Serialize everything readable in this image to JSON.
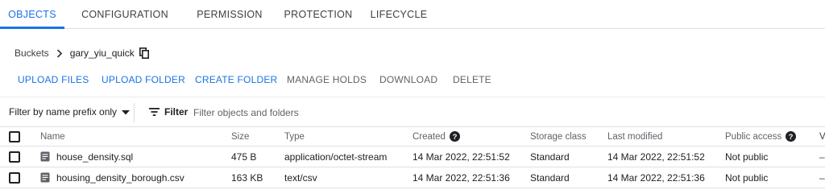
{
  "tabs": [
    {
      "label": "OBJECTS",
      "active": true
    },
    {
      "label": "CONFIGURATION",
      "active": false
    },
    {
      "label": "PERMISSION",
      "active": false
    },
    {
      "label": "PROTECTION",
      "active": false
    },
    {
      "label": "LIFECYCLE",
      "active": false
    }
  ],
  "breadcrumb": {
    "root": "Buckets",
    "current": "gary_yiu_quick"
  },
  "actions": {
    "upload_files": "UPLOAD FILES",
    "upload_folder": "UPLOAD FOLDER",
    "create_folder": "CREATE FOLDER",
    "manage_holds": "MANAGE HOLDS",
    "download": "DOWNLOAD",
    "delete": "DELETE"
  },
  "filter": {
    "prefix_select": "Filter by name prefix only",
    "filter_label": "Filter",
    "placeholder": "Filter objects and folders"
  },
  "table": {
    "columns": {
      "name": "Name",
      "size": "Size",
      "type": "Type",
      "created": "Created",
      "storage_class": "Storage class",
      "last_modified": "Last modified",
      "public_access": "Public access",
      "extra": "V"
    },
    "rows": [
      {
        "name": "house_density.sql",
        "size": "475 B",
        "type": "application/octet-stream",
        "created": "14 Mar 2022, 22:51:52",
        "storage_class": "Standard",
        "last_modified": "14 Mar 2022, 22:51:52",
        "public_access": "Not public",
        "extra": "–"
      },
      {
        "name": "housing_density_borough.csv",
        "size": "163 KB",
        "type": "text/csv",
        "created": "14 Mar 2022, 22:51:36",
        "storage_class": "Standard",
        "last_modified": "14 Mar 2022, 22:51:36",
        "public_access": "Not public",
        "extra": "–"
      }
    ]
  },
  "colors": {
    "accent": "#1a73e8",
    "text": "#202124",
    "muted": "#5f6368",
    "divider": "#e0e0e0"
  },
  "icons": {
    "breadcrumb_separator": "chevron-right-icon",
    "copy": "copy-icon",
    "dropdown": "arrow-drop-down-icon",
    "filter": "filter-list-icon",
    "help": "help-circle-icon",
    "file": "file-icon"
  }
}
